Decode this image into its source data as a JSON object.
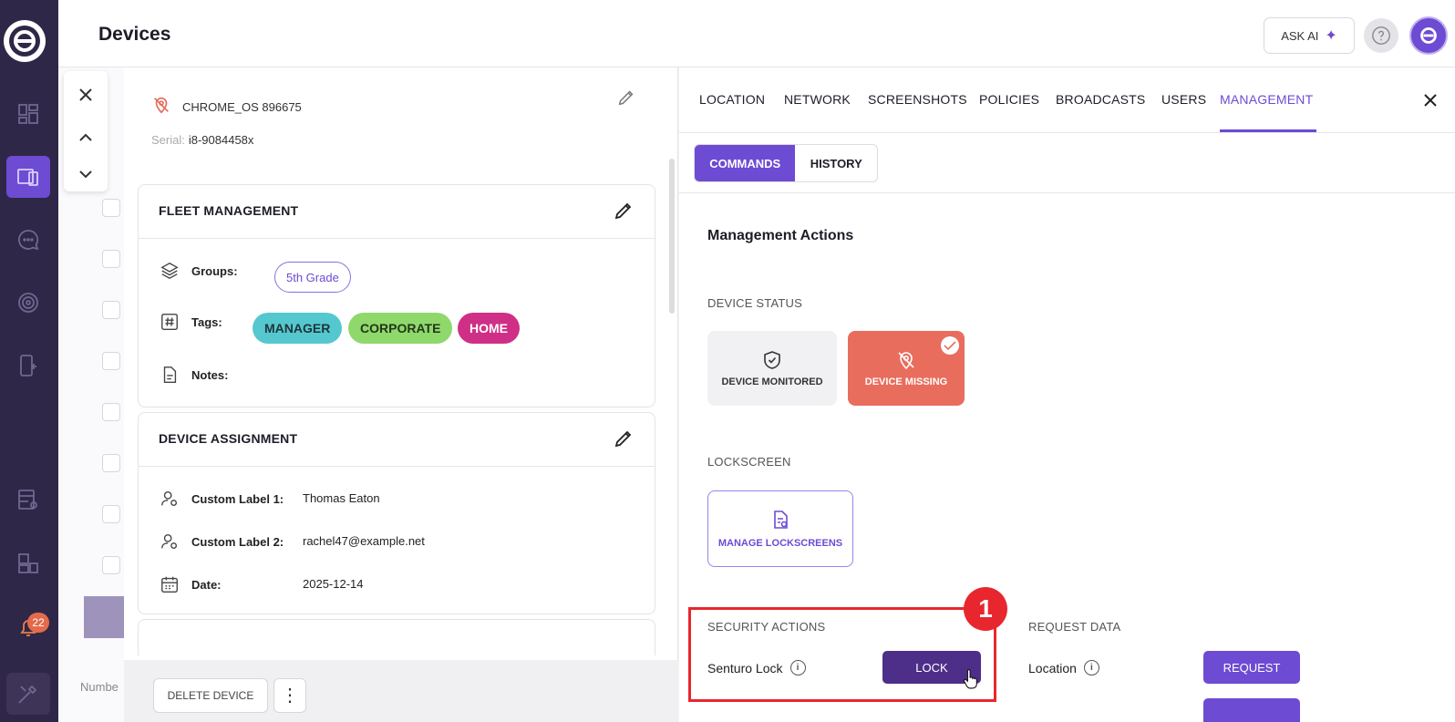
{
  "header": {
    "title": "Devices",
    "ask_ai_label": "ASK AI"
  },
  "sidebar": {
    "notification_count": "22"
  },
  "background": {
    "number_label": "Numbe"
  },
  "device": {
    "name": "CHROME_OS 896675",
    "serial_label": "Serial:",
    "serial_value": "i8-9084458x"
  },
  "fleet_management": {
    "title": "FLEET MANAGEMENT",
    "groups_label": "Groups:",
    "groups": [
      "5th Grade"
    ],
    "tags_label": "Tags:",
    "tags": [
      "MANAGER",
      "CORPORATE",
      "HOME"
    ],
    "notes_label": "Notes:"
  },
  "device_assignment": {
    "title": "DEVICE ASSIGNMENT",
    "custom_label_1": "Custom Label 1:",
    "custom_value_1": "Thomas Eaton",
    "custom_label_2": "Custom Label 2:",
    "custom_value_2": "rachel47@example.net",
    "date_label": "Date:",
    "date_value": "2025-12-14"
  },
  "bottom_actions": {
    "delete_label": "DELETE DEVICE"
  },
  "tabs": [
    "LOCATION",
    "NETWORK",
    "SCREENSHOTS",
    "POLICIES",
    "BROADCASTS",
    "USERS",
    "MANAGEMENT"
  ],
  "active_tab": "MANAGEMENT",
  "subtabs": [
    "COMMANDS",
    "HISTORY"
  ],
  "management": {
    "heading": "Management Actions",
    "device_status_label": "DEVICE STATUS",
    "monitored_label": "DEVICE MONITORED",
    "missing_label": "DEVICE MISSING",
    "lockscreen_label": "LOCKSCREEN",
    "manage_lockscreens_label": "MANAGE LOCKSCREENS",
    "security_actions_label": "SECURITY ACTIONS",
    "senturo_lock_label": "Senturo Lock",
    "lock_button": "LOCK",
    "request_data_label": "REQUEST DATA",
    "location_label": "Location",
    "request_button": "REQUEST"
  },
  "annotation": {
    "step_number": "1"
  },
  "colors": {
    "accent": "#6d4bd3",
    "sidebar": "#2f2748",
    "missing": "#e86d5d",
    "highlight": "#e8262e"
  }
}
